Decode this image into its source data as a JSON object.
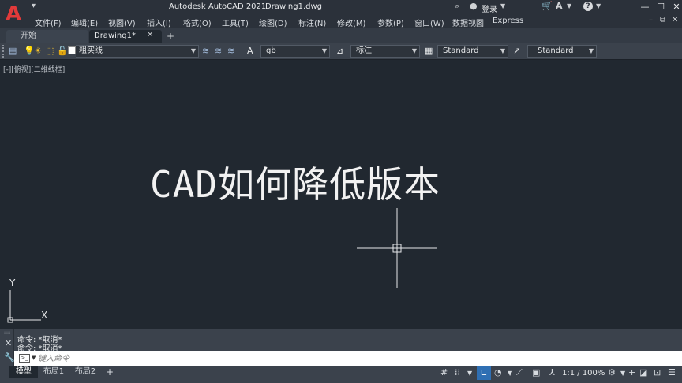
{
  "titlebar": {
    "logo": "A",
    "app_title": "Autodesk AutoCAD 2021",
    "doc_title": "Drawing1.dwg",
    "login_label": "登录",
    "qat_glyph": "▾"
  },
  "menu": {
    "items": [
      "文件(F)",
      "编辑(E)",
      "视图(V)",
      "插入(I)",
      "格式(O)",
      "工具(T)",
      "绘图(D)",
      "标注(N)",
      "修改(M)",
      "参数(P)",
      "窗口(W)",
      "数据视图",
      "Express"
    ]
  },
  "tabs": {
    "start_label": "开始",
    "drawing_label": "Drawing1*",
    "close_glyph": "✕",
    "add_glyph": "+"
  },
  "toolbar": {
    "layer_value": "粗实线",
    "textstyle_value": "gb",
    "dimstyle_value": "标注",
    "tablestyle_value": "Standard",
    "mleaderstyle_value": "Standard"
  },
  "viewport": {
    "label": "[-][俯视][二维线框]",
    "drawing_text": "CAD如何降低版本",
    "ucs_y": "Y",
    "ucs_x": "X"
  },
  "command": {
    "history": [
      "命令: *取消*",
      "命令: *取消*"
    ],
    "placeholder": "键入命令"
  },
  "statusbar": {
    "tabs": [
      "模型",
      "布局1",
      "布局2"
    ],
    "scale": "1:1 / 100%"
  },
  "colors": {
    "canvas": "#212830",
    "chrome": "#3b424c",
    "logo_red": "#e23a3a",
    "active_blue": "#2f6fb3"
  }
}
